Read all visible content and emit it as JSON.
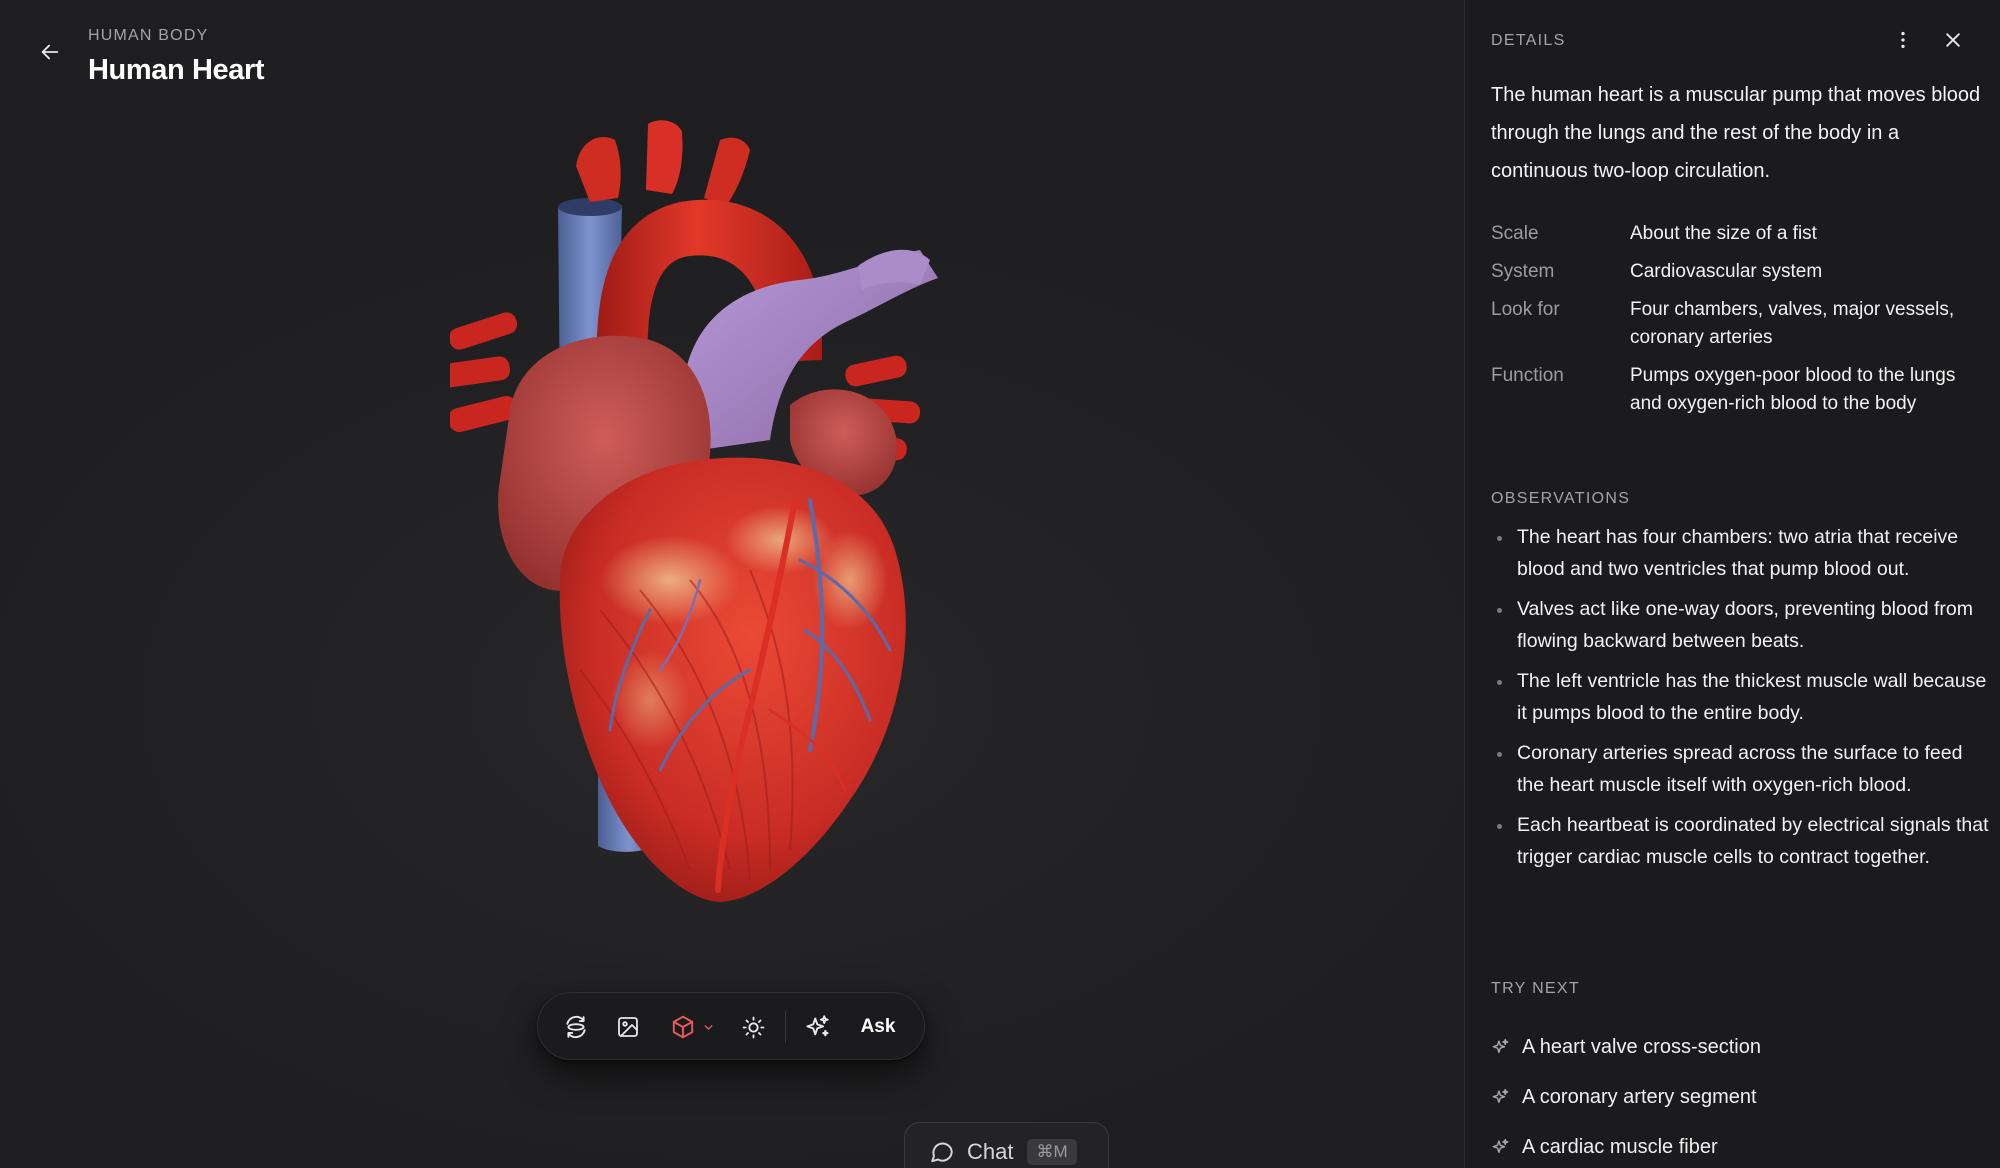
{
  "header": {
    "breadcrumb": "HUMAN BODY",
    "title": "Human Heart"
  },
  "toolbar": {
    "buttons": [
      {
        "name": "rotate",
        "icon": "rotate-3d-icon"
      },
      {
        "name": "image",
        "icon": "image-icon"
      },
      {
        "name": "model",
        "icon": "cube-icon",
        "active": true,
        "accent": "#e8585c"
      },
      {
        "name": "lighting",
        "icon": "sun-icon"
      },
      {
        "name": "generate",
        "icon": "sparkles-icon"
      }
    ],
    "ask_label": "Ask"
  },
  "chat": {
    "label": "Chat",
    "shortcut": "⌘M"
  },
  "details": {
    "header": "DETAILS",
    "summary": "The human heart is a muscular pump that moves blood through the lungs and the rest of the body in a continuous two-loop circulation.",
    "properties": [
      {
        "label": "Scale",
        "value": "About the size of a fist"
      },
      {
        "label": "System",
        "value": "Cardiovascular system"
      },
      {
        "label": "Look for",
        "value": "Four chambers, valves, major vessels, coronary arteries"
      },
      {
        "label": "Function",
        "value": "Pumps oxygen-poor blood to the lungs and oxygen-rich blood to the body"
      }
    ],
    "observations_title": "OBSERVATIONS",
    "observations": [
      "The heart has four chambers: two atria that receive blood and two ventricles that pump blood out.",
      "Valves act like one-way doors, preventing blood from flowing backward between beats.",
      "The left ventricle has the thickest muscle wall because it pumps blood to the entire body.",
      "Coronary arteries spread across the surface to feed the heart muscle itself with oxygen-rich blood.",
      "Each heartbeat is coordinated by electrical signals that trigger cardiac muscle cells to contract together."
    ],
    "try_next_title": "TRY NEXT",
    "try_next": [
      "A heart valve cross-section",
      "A coronary artery segment",
      "A cardiac muscle fiber"
    ]
  },
  "colors": {
    "background": "#202022",
    "panel": "#1b1b1d",
    "accent": "#e8585c"
  }
}
